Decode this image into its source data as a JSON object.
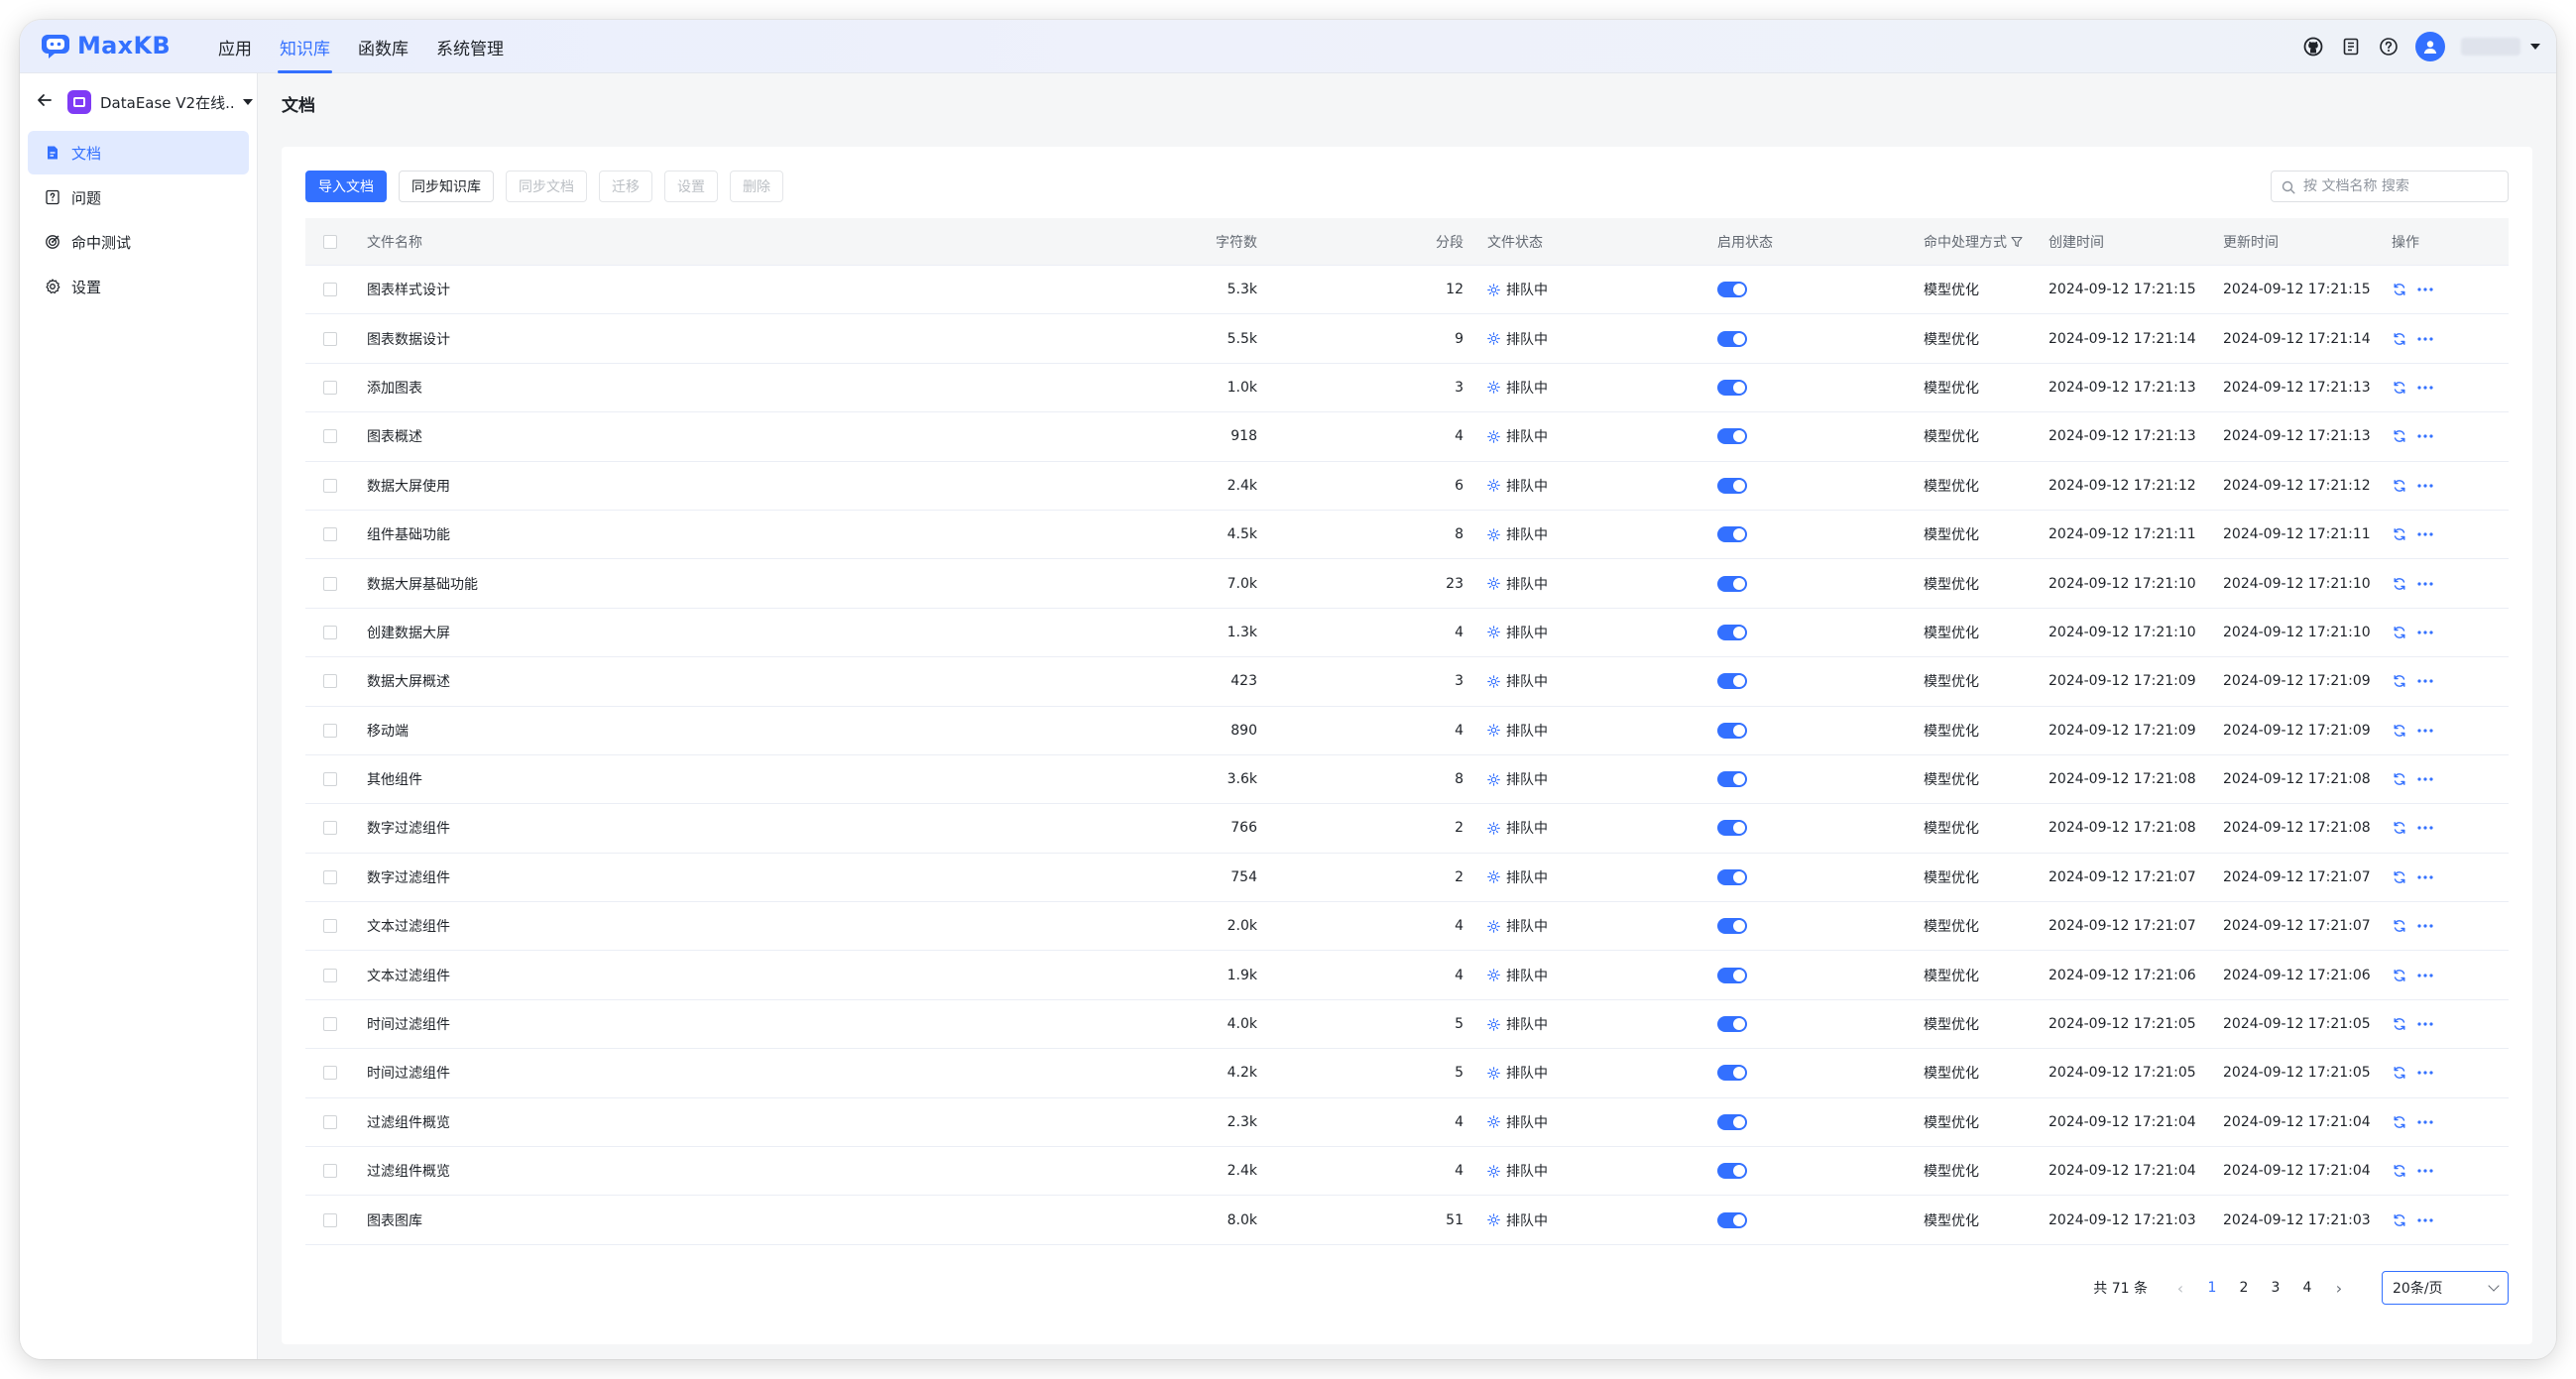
{
  "app": {
    "name": "MaxKB",
    "nav": [
      {
        "label": "应用",
        "active": false
      },
      {
        "label": "知识库",
        "active": true
      },
      {
        "label": "函数库",
        "active": false
      },
      {
        "label": "系统管理",
        "active": false
      }
    ],
    "header_icons": [
      "github-icon",
      "manual-icon",
      "help-icon"
    ],
    "accent": "#3370ff"
  },
  "sidebar": {
    "back_icon": "arrow-left-icon",
    "kb_name": "DataEase V2在线...",
    "items": [
      {
        "label": "文档",
        "icon": "document-icon",
        "active": true
      },
      {
        "label": "问题",
        "icon": "question-icon",
        "active": false
      },
      {
        "label": "命中测试",
        "icon": "target-icon",
        "active": false
      },
      {
        "label": "设置",
        "icon": "gear-icon",
        "active": false
      }
    ]
  },
  "page": {
    "title": "文档",
    "toolbar": {
      "import": "导入文档",
      "sync_kb": "同步知识库",
      "sync_doc": "同步文档",
      "migrate": "迁移",
      "settings": "设置",
      "delete": "删除"
    },
    "search": {
      "placeholder": "按 文档名称 搜索"
    },
    "table": {
      "headers": {
        "name": "文件名称",
        "chars": "字符数",
        "segments": "分段",
        "status": "文件状态",
        "enabled": "启用状态",
        "method": "命中处理方式",
        "created": "创建时间",
        "updated": "更新时间",
        "actions": "操作"
      },
      "rows": [
        {
          "name": "图表样式设计",
          "chars": "5.3k",
          "segments": "12",
          "status": "排队中",
          "enabled": true,
          "method": "模型优化",
          "created": "2024-09-12 17:21:15",
          "updated": "2024-09-12 17:21:15"
        },
        {
          "name": "图表数据设计",
          "chars": "5.5k",
          "segments": "9",
          "status": "排队中",
          "enabled": true,
          "method": "模型优化",
          "created": "2024-09-12 17:21:14",
          "updated": "2024-09-12 17:21:14"
        },
        {
          "name": "添加图表",
          "chars": "1.0k",
          "segments": "3",
          "status": "排队中",
          "enabled": true,
          "method": "模型优化",
          "created": "2024-09-12 17:21:13",
          "updated": "2024-09-12 17:21:13"
        },
        {
          "name": "图表概述",
          "chars": "918",
          "segments": "4",
          "status": "排队中",
          "enabled": true,
          "method": "模型优化",
          "created": "2024-09-12 17:21:13",
          "updated": "2024-09-12 17:21:13"
        },
        {
          "name": "数据大屏使用",
          "chars": "2.4k",
          "segments": "6",
          "status": "排队中",
          "enabled": true,
          "method": "模型优化",
          "created": "2024-09-12 17:21:12",
          "updated": "2024-09-12 17:21:12"
        },
        {
          "name": "组件基础功能",
          "chars": "4.5k",
          "segments": "8",
          "status": "排队中",
          "enabled": true,
          "method": "模型优化",
          "created": "2024-09-12 17:21:11",
          "updated": "2024-09-12 17:21:11"
        },
        {
          "name": "数据大屏基础功能",
          "chars": "7.0k",
          "segments": "23",
          "status": "排队中",
          "enabled": true,
          "method": "模型优化",
          "created": "2024-09-12 17:21:10",
          "updated": "2024-09-12 17:21:10"
        },
        {
          "name": "创建数据大屏",
          "chars": "1.3k",
          "segments": "4",
          "status": "排队中",
          "enabled": true,
          "method": "模型优化",
          "created": "2024-09-12 17:21:10",
          "updated": "2024-09-12 17:21:10"
        },
        {
          "name": "数据大屏概述",
          "chars": "423",
          "segments": "3",
          "status": "排队中",
          "enabled": true,
          "method": "模型优化",
          "created": "2024-09-12 17:21:09",
          "updated": "2024-09-12 17:21:09"
        },
        {
          "name": "移动端",
          "chars": "890",
          "segments": "4",
          "status": "排队中",
          "enabled": true,
          "method": "模型优化",
          "created": "2024-09-12 17:21:09",
          "updated": "2024-09-12 17:21:09"
        },
        {
          "name": "其他组件",
          "chars": "3.6k",
          "segments": "8",
          "status": "排队中",
          "enabled": true,
          "method": "模型优化",
          "created": "2024-09-12 17:21:08",
          "updated": "2024-09-12 17:21:08"
        },
        {
          "name": "数字过滤组件",
          "chars": "766",
          "segments": "2",
          "status": "排队中",
          "enabled": true,
          "method": "模型优化",
          "created": "2024-09-12 17:21:08",
          "updated": "2024-09-12 17:21:08"
        },
        {
          "name": "数字过滤组件",
          "chars": "754",
          "segments": "2",
          "status": "排队中",
          "enabled": true,
          "method": "模型优化",
          "created": "2024-09-12 17:21:07",
          "updated": "2024-09-12 17:21:07"
        },
        {
          "name": "文本过滤组件",
          "chars": "2.0k",
          "segments": "4",
          "status": "排队中",
          "enabled": true,
          "method": "模型优化",
          "created": "2024-09-12 17:21:07",
          "updated": "2024-09-12 17:21:07"
        },
        {
          "name": "文本过滤组件",
          "chars": "1.9k",
          "segments": "4",
          "status": "排队中",
          "enabled": true,
          "method": "模型优化",
          "created": "2024-09-12 17:21:06",
          "updated": "2024-09-12 17:21:06"
        },
        {
          "name": "时间过滤组件",
          "chars": "4.0k",
          "segments": "5",
          "status": "排队中",
          "enabled": true,
          "method": "模型优化",
          "created": "2024-09-12 17:21:05",
          "updated": "2024-09-12 17:21:05"
        },
        {
          "name": "时间过滤组件",
          "chars": "4.2k",
          "segments": "5",
          "status": "排队中",
          "enabled": true,
          "method": "模型优化",
          "created": "2024-09-12 17:21:05",
          "updated": "2024-09-12 17:21:05"
        },
        {
          "name": "过滤组件概览",
          "chars": "2.3k",
          "segments": "4",
          "status": "排队中",
          "enabled": true,
          "method": "模型优化",
          "created": "2024-09-12 17:21:04",
          "updated": "2024-09-12 17:21:04"
        },
        {
          "name": "过滤组件概览",
          "chars": "2.4k",
          "segments": "4",
          "status": "排队中",
          "enabled": true,
          "method": "模型优化",
          "created": "2024-09-12 17:21:04",
          "updated": "2024-09-12 17:21:04"
        },
        {
          "name": "图表图库",
          "chars": "8.0k",
          "segments": "51",
          "status": "排队中",
          "enabled": true,
          "method": "模型优化",
          "created": "2024-09-12 17:21:03",
          "updated": "2024-09-12 17:21:03"
        }
      ]
    },
    "pagination": {
      "total": "共 71 条",
      "pages": [
        "1",
        "2",
        "3",
        "4"
      ],
      "current": "1",
      "page_size": "20条/页"
    }
  }
}
